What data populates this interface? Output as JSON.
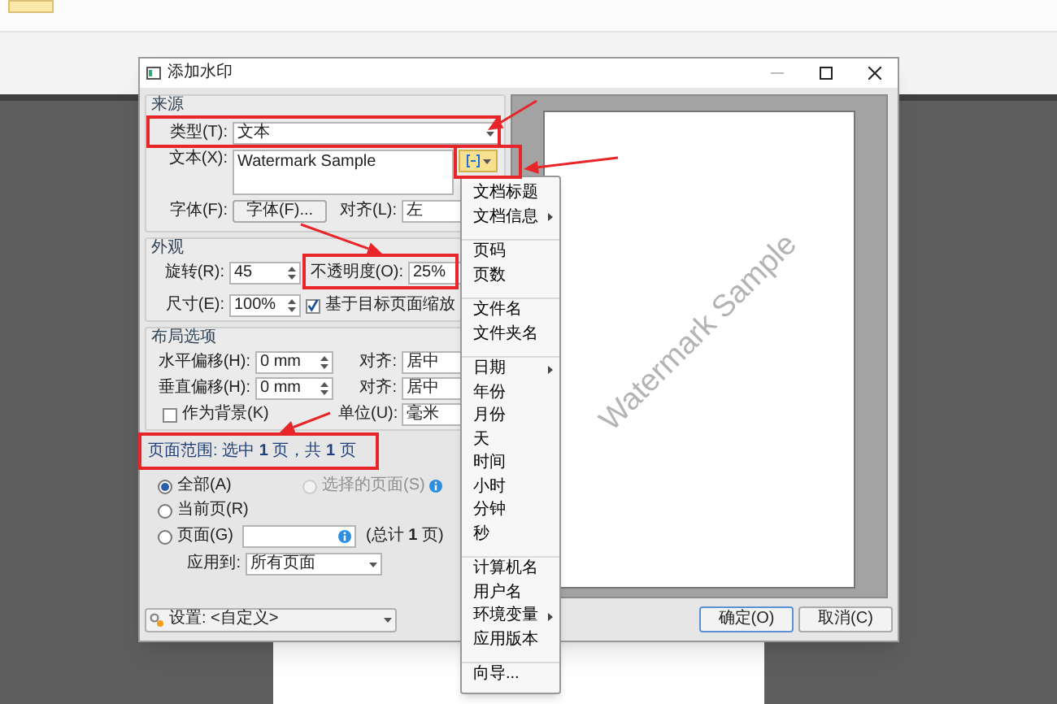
{
  "dialog": {
    "title": "添加水印",
    "source": {
      "heading": "来源",
      "type_label": "类型(T):",
      "type_value": "文本",
      "text_label": "文本(X):",
      "text_value": "Watermark Sample",
      "font_label": "字体(F):",
      "font_button": "字体(F)...",
      "align_label": "对齐(L):",
      "align_value": "左"
    },
    "appearance": {
      "heading": "外观",
      "rotation_label": "旋转(R):",
      "rotation_value": "45",
      "opacity_label": "不透明度(O):",
      "opacity_value": "25%",
      "size_label": "尺寸(E):",
      "size_value": "100%",
      "scale_checkbox": {
        "label": "基于目标页面缩放",
        "checked": true
      }
    },
    "layout": {
      "heading": "布局选项",
      "h_offset_label": "水平偏移(H):",
      "h_offset_value": "0 mm",
      "h_align_label": "对齐:",
      "h_align_value": "居中",
      "v_offset_label": "垂直偏移(H):",
      "v_offset_value": "0 mm",
      "v_align_label": "对齐:",
      "v_align_value": "居中",
      "background_checkbox": {
        "label": "作为背景(K)",
        "checked": false
      },
      "unit_label": "单位(U):",
      "unit_value": "毫米"
    },
    "page_range": {
      "summary": "页面范围: 选中 **1** 页，共 **1** 页",
      "options": [
        {
          "label": "全部(A)",
          "selected": true,
          "disabled": false
        },
        {
          "label": "选择的页面(S)",
          "selected": false,
          "disabled": true
        },
        {
          "label": "当前页(R)",
          "selected": false,
          "disabled": false
        },
        {
          "label": "页面(G)",
          "selected": false,
          "disabled": false
        }
      ],
      "pages_total": "(总计 **1** 页)",
      "apply_label": "应用到:",
      "apply_value": "所有页面"
    },
    "settings": {
      "label": "设置: <自定义>"
    },
    "buttons": [
      {
        "label": "确定(O)",
        "default": true
      },
      {
        "label": "取消(C)",
        "default": false
      }
    ]
  },
  "insert_menu": {
    "groups": [
      [
        {
          "label": "文档标题",
          "submenu": false
        },
        {
          "label": "文档信息",
          "submenu": true
        }
      ],
      [
        {
          "label": "页码",
          "submenu": false
        },
        {
          "label": "页数",
          "submenu": false
        }
      ],
      [
        {
          "label": "文件名",
          "submenu": false
        },
        {
          "label": "文件夹名",
          "submenu": false
        }
      ],
      [
        {
          "label": "日期",
          "submenu": true
        },
        {
          "label": "年份",
          "submenu": false
        },
        {
          "label": "月份",
          "submenu": false
        },
        {
          "label": "天",
          "submenu": false
        },
        {
          "label": "时间",
          "submenu": false
        },
        {
          "label": "小时",
          "submenu": false
        },
        {
          "label": "分钟",
          "submenu": false
        },
        {
          "label": "秒",
          "submenu": false
        }
      ],
      [
        {
          "label": "计算机名",
          "submenu": false
        },
        {
          "label": "用户名",
          "submenu": false
        },
        {
          "label": "环境变量",
          "submenu": true
        },
        {
          "label": "应用版本",
          "submenu": false
        }
      ],
      [
        {
          "label": "向导...",
          "submenu": false
        }
      ]
    ]
  },
  "preview": {
    "watermark_text": "Watermark Sample"
  }
}
